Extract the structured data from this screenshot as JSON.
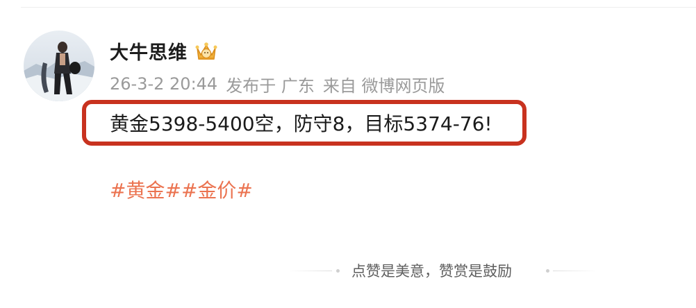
{
  "post": {
    "author": {
      "name": "大牛思维",
      "badge_icon": "crown-vip-icon"
    },
    "meta": {
      "timestamp": "26-3-2 20:44",
      "location": "发布于 广东",
      "source": "来自 微博网页版"
    },
    "text": "黄金5398-5400空，防守8，目标5374-76!",
    "hashtags": [
      "#黄金#",
      "#金价#"
    ]
  },
  "reward": {
    "label": "点赞是美意，赞赏是鼓励"
  },
  "colors": {
    "highlight_border": "#c8321f",
    "hashtag": "#eb7350",
    "meta_text": "#9a9a9a"
  }
}
